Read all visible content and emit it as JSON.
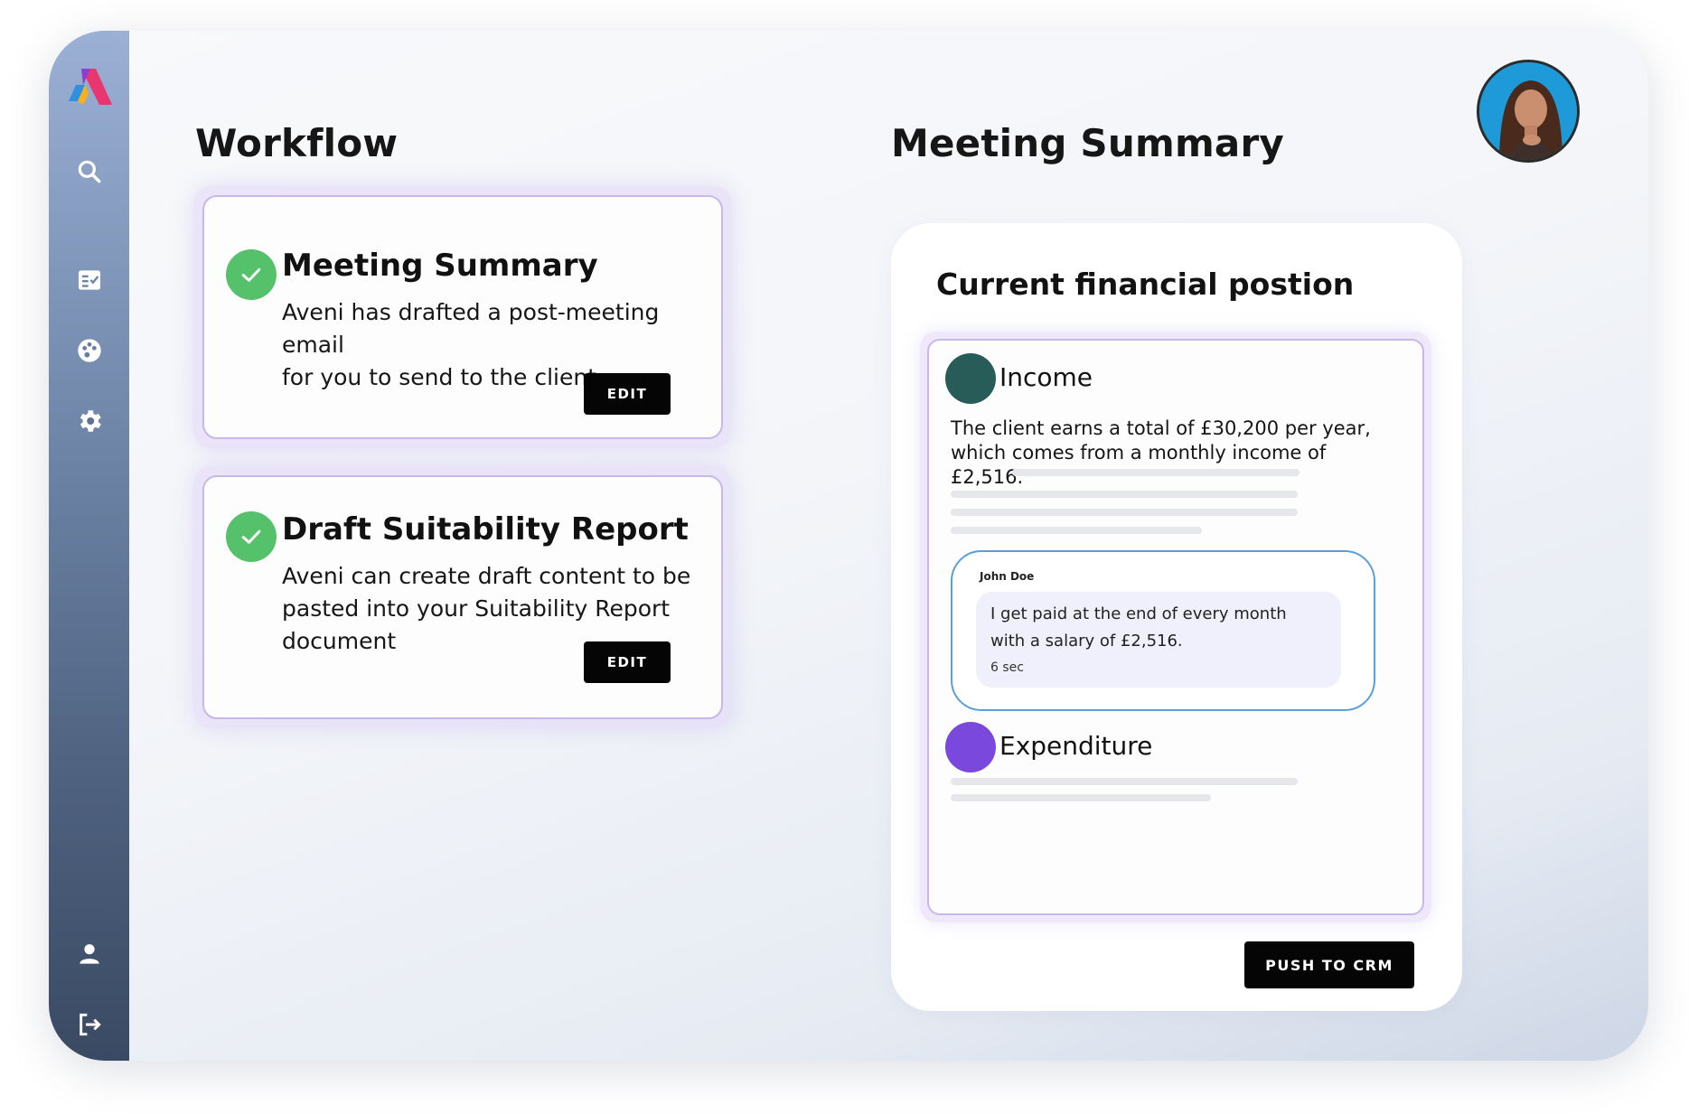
{
  "sidebar": {
    "logo": "aveni-logo",
    "icons": [
      "search-icon",
      "task-list-icon",
      "palette-icon",
      "settings-icon",
      "user-icon",
      "logout-icon"
    ]
  },
  "workflow": {
    "heading": "Workflow",
    "cards": [
      {
        "title": "Meeting Summary",
        "description_lines": [
          "Aveni has drafted a post-meeting email",
          "for you to send to the client"
        ],
        "button_label": "EDIT",
        "status": "complete"
      },
      {
        "title": "Draft Suitability Report",
        "description_lines": [
          "Aveni can create draft content to be",
          "pasted into your Suitability Report",
          "document"
        ],
        "button_label": "EDIT",
        "status": "complete"
      }
    ]
  },
  "summary": {
    "heading": "Meeting Summary",
    "subtitle": "Current financial postion",
    "income": {
      "label": "Income",
      "color": "#275c58",
      "text_lines": [
        "The client earns a total of £30,200 per year,",
        "which comes from a monthly income of",
        "£2,516."
      ]
    },
    "transcript": {
      "speaker": "John Doe",
      "message_lines": [
        "I get paid at the end of every month",
        "with a salary of £2,516."
      ],
      "time": "6 sec"
    },
    "expenditure": {
      "label": "Expenditure",
      "color": "#7a48dc"
    },
    "push_button_label": "PUSH TO CRM"
  },
  "colors": {
    "check_green": "#56c16b",
    "card_border": "#c7b8ec",
    "transcript_border": "#5a9fd8",
    "button_black": "#050505"
  }
}
